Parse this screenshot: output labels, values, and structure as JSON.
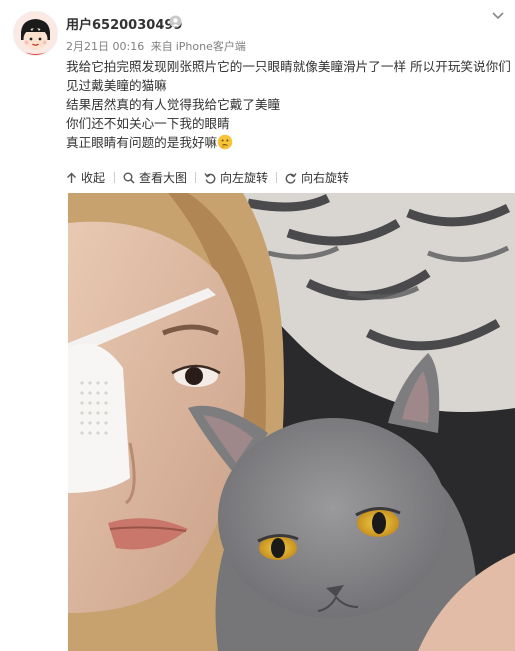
{
  "post": {
    "username": "用户6520030499",
    "date": "2月21日 00:16",
    "source_prefix": "来自",
    "source": "iPhone客户端",
    "text_lines": [
      "我给它拍完照发现刚张照片它的一只眼睛就像美瞳滑片了一样 所以开玩笑说你们",
      "见过戴美瞳的猫嘛",
      "结果居然真的有人觉得我给它戴了美瞳",
      "你们还不如关心一下我的眼睛",
      "真正眼睛有问题的是我好嘛"
    ],
    "emoji": "thinking-emoji"
  },
  "toolbar": {
    "collapse": "收起",
    "view_large": "查看大图",
    "rotate_left": "向左旋转",
    "rotate_right": "向右旋转"
  },
  "icons": {
    "verify": "verify-badge-icon",
    "more": "chevron-down-icon"
  },
  "colors": {
    "text": "#333333",
    "meta": "#808080"
  }
}
